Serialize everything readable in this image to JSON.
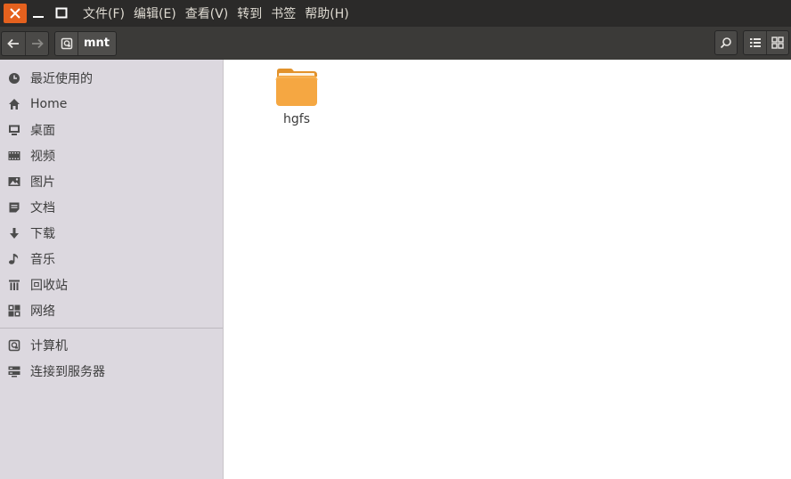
{
  "menubar": {
    "items": [
      "文件(F)",
      "编辑(E)",
      "查看(V)",
      "转到",
      "书签",
      "帮助(H)"
    ]
  },
  "toolbar": {
    "path": "mnt"
  },
  "sidebar": {
    "places": [
      {
        "label": "最近使用的",
        "icon": "clock-icon"
      },
      {
        "label": "Home",
        "icon": "home-icon"
      },
      {
        "label": "桌面",
        "icon": "desktop-icon"
      },
      {
        "label": "视频",
        "icon": "video-icon"
      },
      {
        "label": "图片",
        "icon": "pictures-icon"
      },
      {
        "label": "文档",
        "icon": "document-icon"
      },
      {
        "label": "下载",
        "icon": "download-icon"
      },
      {
        "label": "音乐",
        "icon": "music-icon"
      },
      {
        "label": "回收站",
        "icon": "trash-icon"
      },
      {
        "label": "网络",
        "icon": "network-icon"
      }
    ],
    "devices": [
      {
        "label": "计算机",
        "icon": "computer-icon"
      },
      {
        "label": "连接到服务器",
        "icon": "server-icon"
      }
    ]
  },
  "content": {
    "files": [
      {
        "name": "hgfs",
        "icon": "folder-icon"
      }
    ]
  },
  "colors": {
    "close_button": "#e5611e",
    "menubar_bg": "#2b2a29",
    "toolbar_bg": "#3b3a38",
    "sidebar_bg": "#dcd8df",
    "folder": "#f5a742"
  }
}
